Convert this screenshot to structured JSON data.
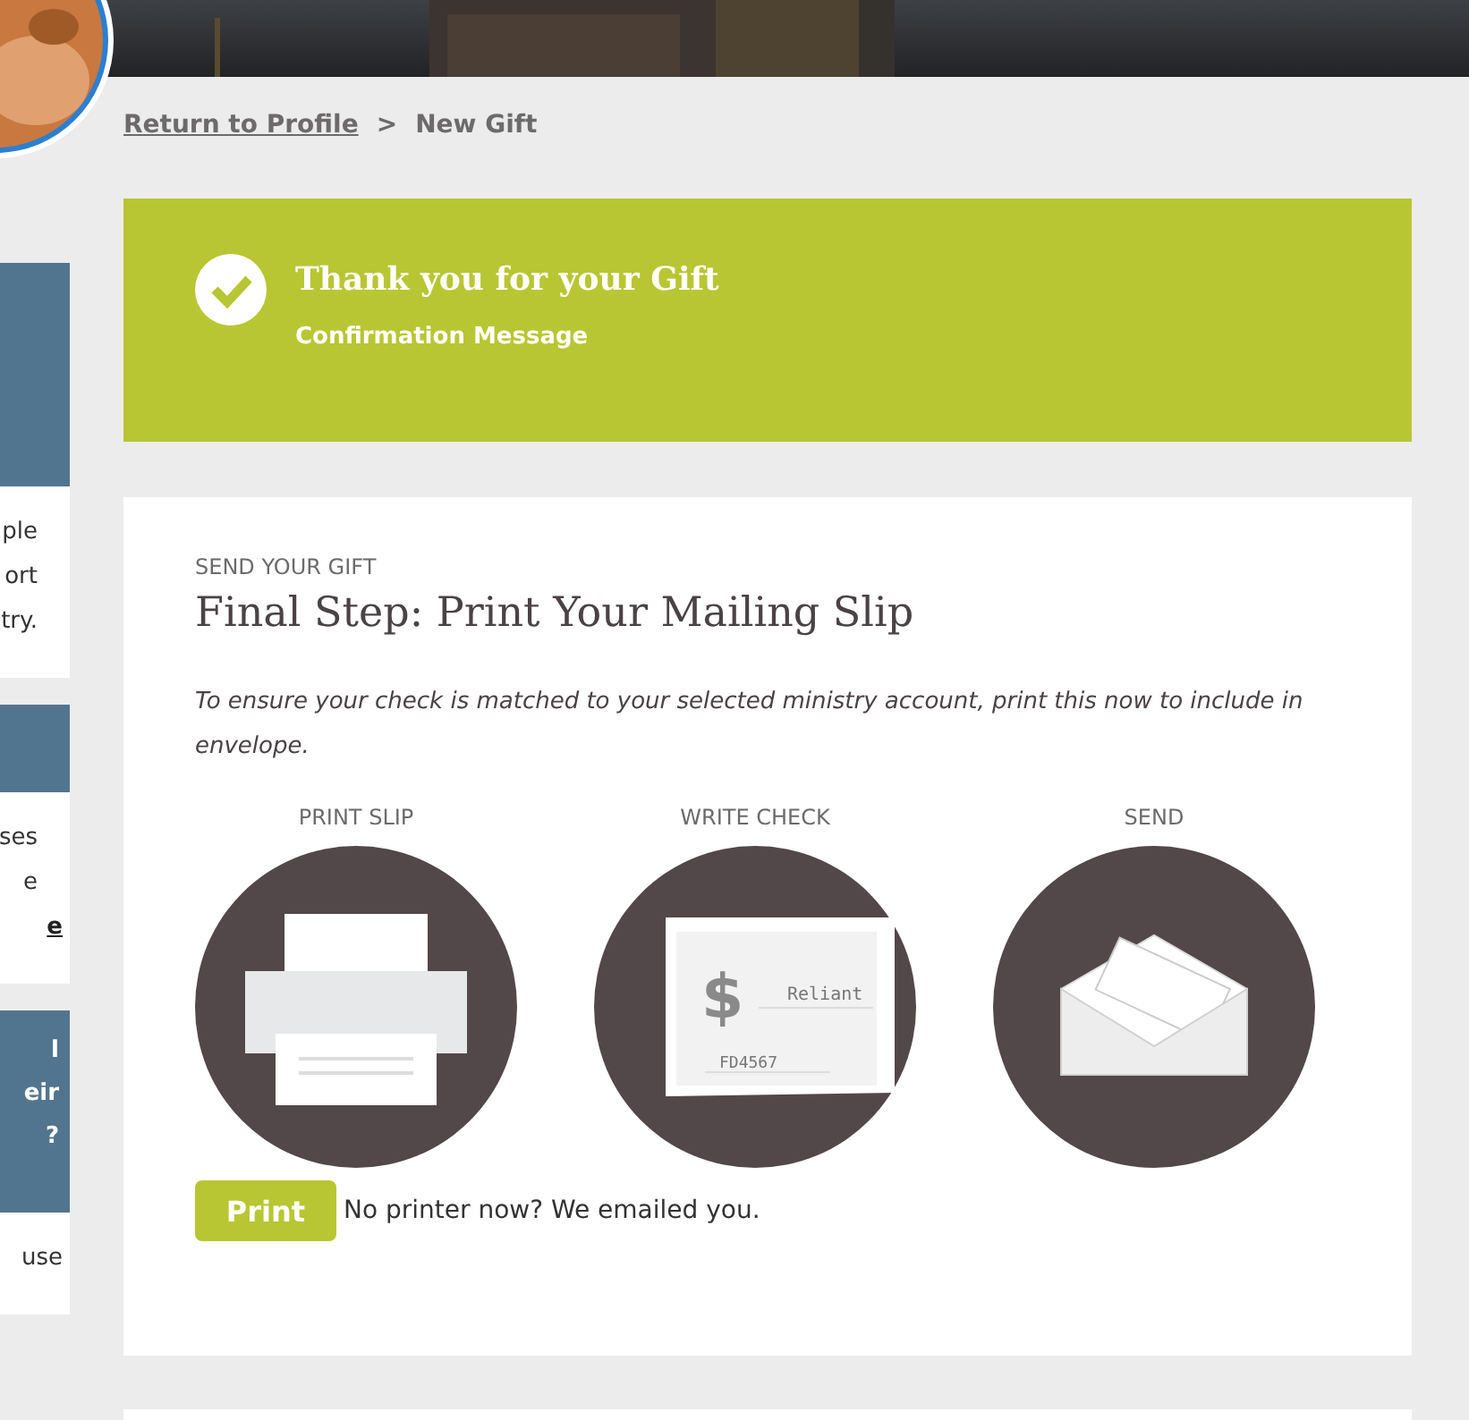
{
  "sidebar": {
    "cards": [
      {
        "body_lines": [
          {
            "text": "ple",
            "link": false
          },
          {
            "text": "ort",
            "link": false
          },
          {
            "text": "try.",
            "link": false
          }
        ]
      },
      {
        "body_lines": [
          {
            "text": "ses",
            "link": false
          },
          {
            "text": "e",
            "link": false
          },
          {
            "text": "e",
            "link": true
          }
        ]
      },
      {
        "header_lines": [
          "l",
          "eir",
          "?"
        ],
        "body_lines": [
          {
            "text": "use",
            "link": false
          }
        ]
      }
    ]
  },
  "breadcrumb": {
    "link": "Return to Profile",
    "separator": ">",
    "current": "New Gift"
  },
  "banner": {
    "title": "Thank you for your Gift",
    "subtitle": "Confirmation Message"
  },
  "card": {
    "eyebrow": "SEND YOUR GIFT",
    "title": "Final Step: Print Your Mailing Slip",
    "description": "To ensure your check is matched to your selected ministry account, print this now to include in envelope.",
    "steps": [
      {
        "kind": "printer",
        "label": "PRINT SLIP"
      },
      {
        "kind": "check",
        "label": "WRITE CHECK",
        "symbol": "$",
        "payee": "Reliant",
        "memo": "FD4567"
      },
      {
        "kind": "envelope",
        "label": "SEND"
      }
    ],
    "button": "Print",
    "note": "No printer now? We emailed you."
  }
}
